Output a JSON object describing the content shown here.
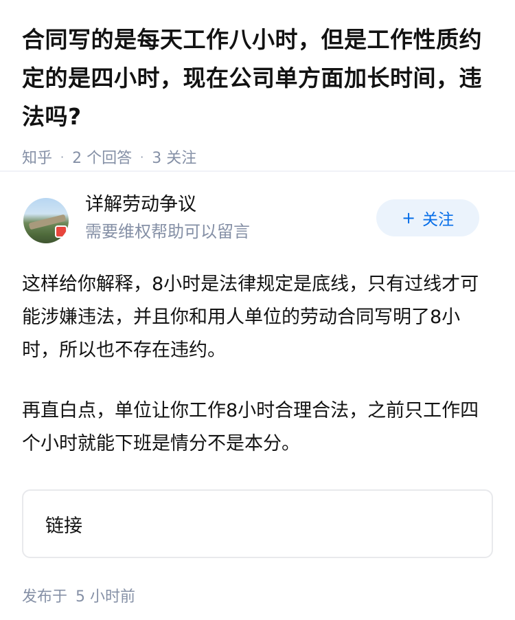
{
  "question": {
    "title": "合同写的是每天工作八小时，但是工作性质约定的是四小时，现在公司单方面加长时间，违法吗?",
    "source": "知乎",
    "answers": "2 个回答",
    "followers": "3 关注",
    "separator": "·"
  },
  "author": {
    "name": "详解劳动争议",
    "bio": "需要维权帮助可以留言",
    "follow_label": "关注",
    "follow_icon": "+",
    "avatar_icon": "great-wall-photo",
    "badge_color": "#e8453c"
  },
  "answer": {
    "paragraphs": [
      "这样给你解释，8小时是法律规定是底线，只有过线才可能涉嫌违法，并且你和用人单位的劳动合同写明了8小时，所以也不存在违约。",
      "再直白点，单位让你工作8小时合理合法，之前只工作四个小时就能下班是情分不是本分。"
    ],
    "link_label": "链接",
    "published_prefix": "发布于",
    "published_time": "5 小时前"
  },
  "colors": {
    "accent": "#056de8",
    "muted": "#8590a6",
    "text": "#121212",
    "follow_bg": "#ebf3fc"
  }
}
